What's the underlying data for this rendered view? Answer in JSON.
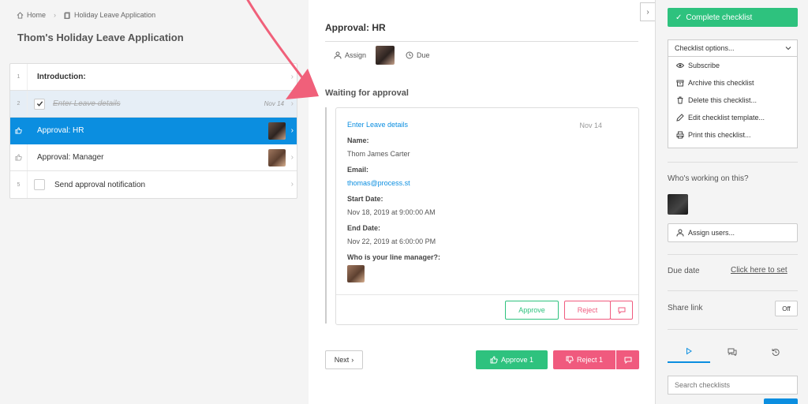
{
  "breadcrumb": {
    "home": "Home",
    "current": "Holiday Leave Application"
  },
  "page_title": "Thom's Holiday Leave Application",
  "tasks": [
    {
      "num": "1",
      "label": "Introduction:"
    },
    {
      "num": "2",
      "label": "Enter Leave details",
      "date": "Nov 14"
    },
    {
      "num": "",
      "label": "Approval: HR"
    },
    {
      "num": "",
      "label": "Approval: Manager"
    },
    {
      "num": "5",
      "label": "Send approval notification"
    }
  ],
  "step": {
    "title": "Approval: HR",
    "assign": "Assign",
    "due": "Due"
  },
  "waiting": "Waiting for approval",
  "card": {
    "link": "Enter Leave details",
    "date": "Nov 14",
    "fields": [
      {
        "label": "Name:",
        "value": "Thom James Carter"
      },
      {
        "label": "Email:",
        "value": "thomas@process.st"
      },
      {
        "label": "Start Date:",
        "value": "Nov 18, 2019 at 9:00:00 AM"
      },
      {
        "label": "End Date:",
        "value": "Nov 22, 2019 at 6:00:00 PM"
      },
      {
        "label": "Who is your line manager?:",
        "value": ""
      }
    ],
    "approve": "Approve",
    "reject": "Reject"
  },
  "footer": {
    "next": "Next",
    "approve": "Approve 1",
    "reject": "Reject 1"
  },
  "sidebar": {
    "complete": "Complete checklist",
    "options": "Checklist options...",
    "menu": [
      {
        "icon": "eye-icon",
        "label": "Subscribe"
      },
      {
        "icon": "archive-icon",
        "label": "Archive this checklist"
      },
      {
        "icon": "trash-icon",
        "label": "Delete this checklist..."
      },
      {
        "icon": "pencil-icon",
        "label": "Edit checklist template..."
      },
      {
        "icon": "printer-icon",
        "label": "Print this checklist..."
      }
    ],
    "working": "Who's working on this?",
    "assign_users": "Assign users...",
    "due_label": "Due date",
    "due_link": "Click here to set",
    "share_label": "Share link",
    "share_toggle": "Off",
    "search_placeholder": "Search checklists"
  },
  "colors": {
    "blue": "#0b8ee0",
    "green": "#2ec27e",
    "red": "#f05a7e",
    "annotation_arrow": "#f0607a"
  }
}
